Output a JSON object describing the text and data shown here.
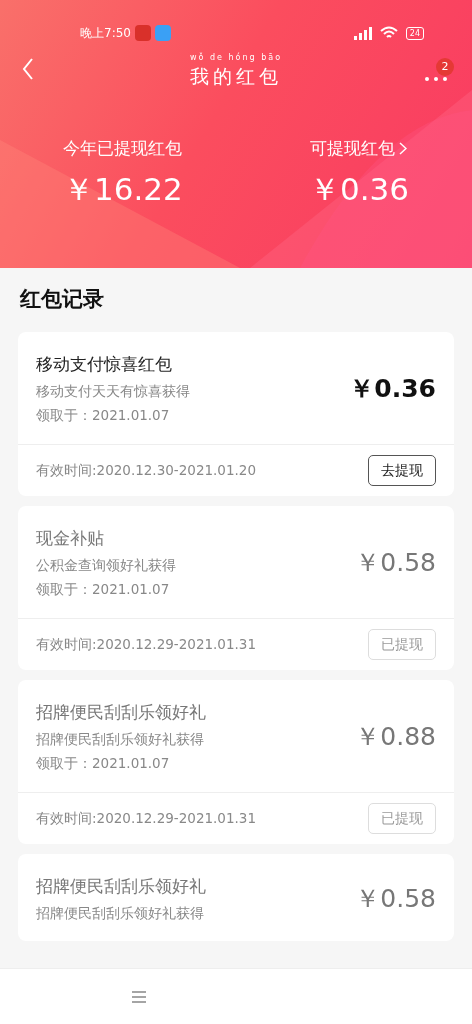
{
  "status_bar": {
    "time": "晚上7:50",
    "battery": "24"
  },
  "header": {
    "title_pinyin": "wǒ de hóng bāo",
    "title": "我的红包",
    "menu_badge": "2"
  },
  "summary": [
    {
      "label": "今年已提现红包",
      "amount": "￥16.22",
      "has_arrow": false
    },
    {
      "label": "可提现红包",
      "amount": "￥0.36",
      "has_arrow": true
    }
  ],
  "section_title": "红包记录",
  "records": [
    {
      "title": "移动支付惊喜红包",
      "source": "移动支付天天有惊喜获得",
      "received": "领取于：2021.01.07",
      "amount": "￥0.36",
      "validity": "有效时间:2020.12.30-2021.01.20",
      "button": "去提现",
      "withdrawn": false
    },
    {
      "title": "现金补贴",
      "source": "公积金查询领好礼获得",
      "received": "领取于：2021.01.07",
      "amount": "￥0.58",
      "validity": "有效时间:2020.12.29-2021.01.31",
      "button": "已提现",
      "withdrawn": true
    },
    {
      "title": "招牌便民刮刮乐领好礼",
      "source": "招牌便民刮刮乐领好礼获得",
      "received": "领取于：2021.01.07",
      "amount": "￥0.88",
      "validity": "有效时间:2020.12.29-2021.01.31",
      "button": "已提现",
      "withdrawn": true
    },
    {
      "title": "招牌便民刮刮乐领好礼",
      "source": "招牌便民刮刮乐领好礼获得",
      "amount": "￥0.58",
      "withdrawn": true
    }
  ]
}
